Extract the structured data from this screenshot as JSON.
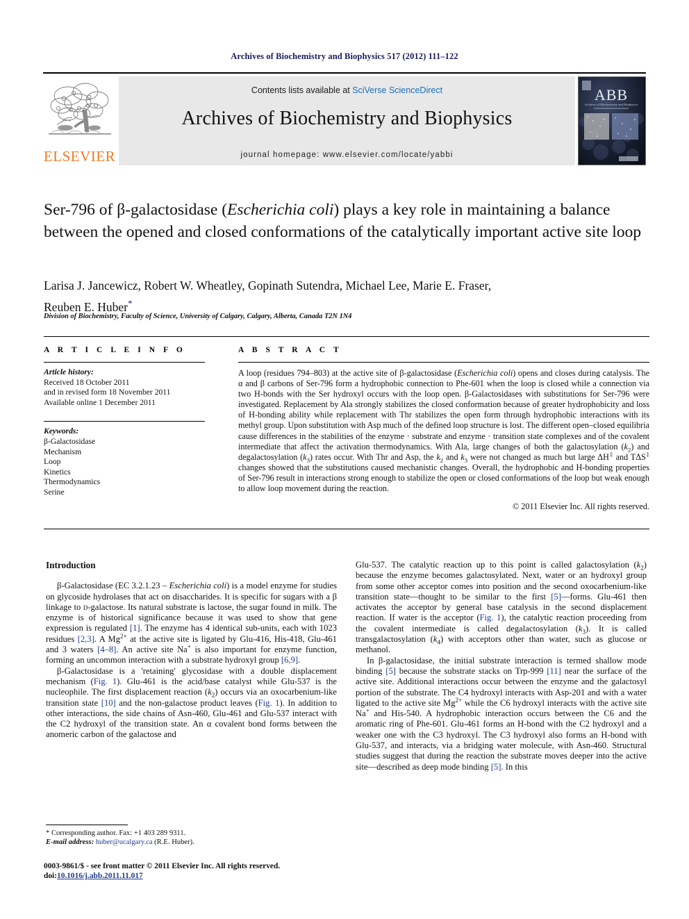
{
  "running_head": "Archives of Biochemistry and Biophysics 517 (2012) 111–122",
  "masthead": {
    "publisher_name": "ELSEVIER",
    "contents_prefix": "Contents lists available at ",
    "contents_link": "SciVerse ScienceDirect",
    "journal_title": "Archives of Biochemistry and Biophysics",
    "homepage_line": "journal homepage: www.elsevier.com/locate/yabbi",
    "cover_title": "ABB",
    "cover_subtitle": "Archives of Biochemistry and Biophysics"
  },
  "article": {
    "title_part1": "Ser-796 of β-galactosidase (",
    "title_italic": "Escherichia coli",
    "title_part2": ") plays a key role in maintaining a balance between the opened and closed conformations of the catalytically important active site loop",
    "authors": "Larisa J. Jancewicz, Robert W. Wheatley, Gopinath Sutendra, Michael Lee, Marie E. Fraser,",
    "authors_line2": "Reuben E. Huber",
    "corresponding_marker": "*",
    "affiliation": "Division of Biochemistry, Faculty of Science, University of Calgary, Calgary, Alberta, Canada T2N 1N4"
  },
  "info": {
    "heading": "A R T I C L E   I N F O",
    "history_label": "Article history:",
    "history_lines": [
      "Received 18 October 2011",
      "and in revised form 18 November 2011",
      "Available online 1 December 2011"
    ],
    "keywords_label": "Keywords:",
    "keywords": [
      "β-Galactosidase",
      "Mechanism",
      "Loop",
      "Kinetics",
      "Thermodynamics",
      "Serine"
    ]
  },
  "abstract": {
    "heading": "A B S T R A C T",
    "text": "A loop (residues 794–803) at the active site of β-galactosidase (Escherichia coli) opens and closes during catalysis. The α and β carbons of Ser-796 form a hydrophobic connection to Phe-601 when the loop is closed while a connection via two H-bonds with the Ser hydroxyl occurs with the loop open. β-Galactosidases with substitutions for Ser-796 were investigated. Replacement by Ala strongly stabilizes the closed conformation because of greater hydrophobicity and loss of H-bonding ability while replacement with Thr stabilizes the open form through hydrophobic interactions with its methyl group. Upon substitution with Asp much of the defined loop structure is lost. The different open–closed equilibria cause differences in the stabilities of the enzyme · substrate and enzyme · transition state complexes and of the covalent intermediate that affect the activation thermodynamics. With Ala, large changes of both the galactosylation (k2) and degalactosylation (k3) rates occur. With Thr and Asp, the k2 and k3 were not changed as much but large ΔH‡ and TΔS‡ changes showed that the substitutions caused mechanistic changes. Overall, the hydrophobic and H-bonding properties of Ser-796 result in interactions strong enough to stabilize the open or closed conformations of the loop but weak enough to allow loop movement during the reaction.",
    "copyright": "© 2011 Elsevier Inc. All rights reserved."
  },
  "body": {
    "intro_heading": "Introduction",
    "left_paragraphs": [
      "β-Galactosidase (EC 3.2.1.23 – Escherichia coli) is a model enzyme for studies on glycoside hydrolases that act on disaccharides. It is specific for sugars with a β linkage to D-galactose. Its natural substrate is lactose, the sugar found in milk. The enzyme is of historical significance because it was used to show that gene expression is regulated [1]. The enzyme has 4 identical sub-units, each with 1023 residues [2,3]. A Mg2+ at the active site is ligated by Glu-416, His-418, Glu-461 and 3 waters [4–8]. An active site Na+ is also important for enzyme function, forming an uncommon interaction with a substrate hydroxyl group [6,9].",
      "β-Galactosidase is a 'retaining' glycosidase with a double displacement mechanism (Fig. 1). Glu-461 is the acid/base catalyst while Glu-537 is the nucleophile. The first displacement reaction (k2) occurs via an oxocarbenium-like transition state [10] and the non-galactose product leaves (Fig. 1). In addition to other interactions, the side chains of Asn-460, Glu-461 and Glu-537 interact with the C2 hydroxyl of the transition state. An α covalent bond forms between the anomeric carbon of the galactose and"
    ],
    "right_paragraphs": [
      "Glu-537. The catalytic reaction up to this point is called galactosylation (k2) because the enzyme becomes galactosylated. Next, water or an hydroxyl group from some other acceptor comes into position and the second oxocarbenium-like transition state—thought to be similar to the first [5]—forms. Glu-461 then activates the acceptor by general base catalysis in the second displacement reaction. If water is the acceptor (Fig. 1), the catalytic reaction proceeding from the covalent intermediate is called degalactosylation (k3). It is called transgalactosylation (k4) with acceptors other than water, such as glucose or methanol.",
      "In β-galactosidase, the initial substrate interaction is termed shallow mode binding [5] because the substrate stacks on Trp-999 [11] near the surface of the active site. Additional interactions occur between the enzyme and the galactosyl portion of the substrate. The C4 hydroxyl interacts with Asp-201 and with a water ligated to the active site Mg2+ while the C6 hydroxyl interacts with the active site Na+ and His-540. A hydrophobic interaction occurs between the C6 and the aromatic ring of Phe-601. Glu-461 forms an H-bond with the C2 hydroxyl and a weaker one with the C3 hydroxyl. The C3 hydroxyl also forms an H-bond with Glu-537, and interacts, via a bridging water molecule, with Asn-460. Structural studies suggest that during the reaction the substrate moves deeper into the active site—described as deep mode binding [5]. In this"
    ]
  },
  "footnotes": {
    "corresponding": "* Corresponding author. Fax: +1 403 289 9311.",
    "email_label": "E-mail address:",
    "email": "huber@ucalgary.ca",
    "email_suffix": " (R.E. Huber)."
  },
  "imprint": {
    "line1": "0003-9861/$ - see front matter © 2011 Elsevier Inc. All rights reserved.",
    "doi_label": "doi:",
    "doi": "10.1016/j.abb.2011.11.017"
  },
  "colors": {
    "link": "#1c6fb8",
    "reference": "#1d3c8f",
    "running_head": "#1a1a5e",
    "elsevier_orange": "#f47920",
    "band_gray": "#e8e8e8"
  }
}
